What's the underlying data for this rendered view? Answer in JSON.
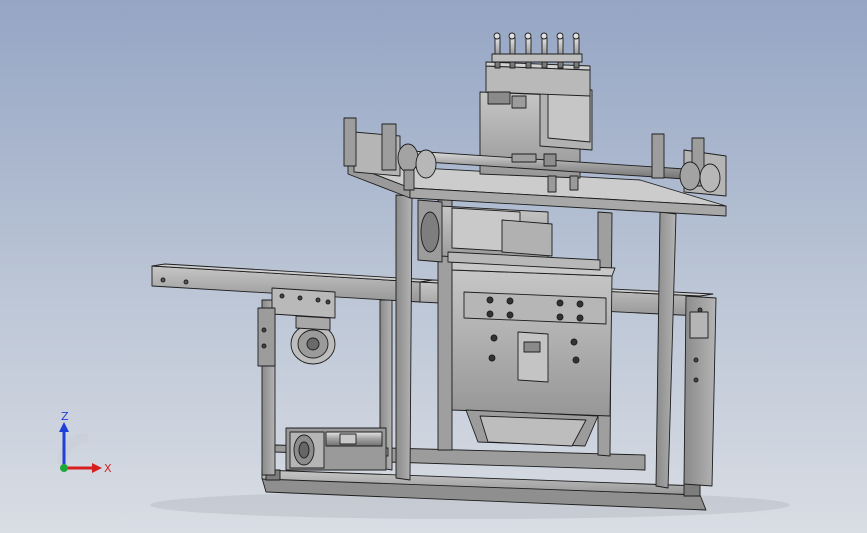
{
  "viewport": {
    "background_top": "#95a5c4",
    "background_bottom": "#d9dde4"
  },
  "model": {
    "part_fill": "#a9a9a9",
    "part_dark": "#7c7c7c",
    "part_light": "#c8c8c8",
    "edge_color": "#1e1e1e"
  },
  "triad": {
    "z_label": "Z",
    "x_label": "X",
    "z_color": "#1f3fd8",
    "x_color": "#d81f1f",
    "y_color": "#1fa83a"
  }
}
